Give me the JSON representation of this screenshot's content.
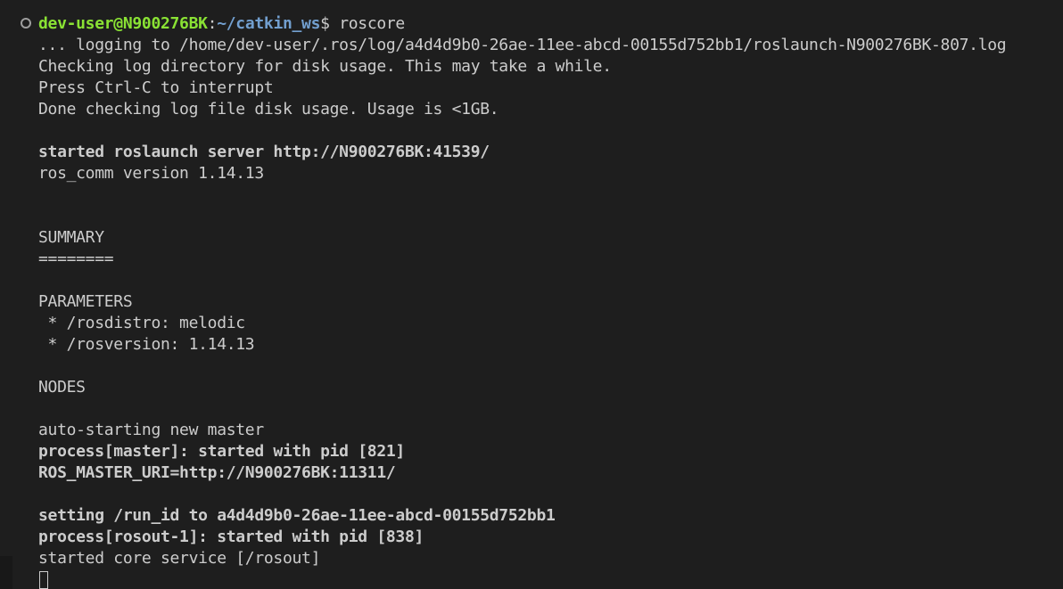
{
  "prompt": {
    "user_host": "dev-user@N900276BK",
    "separator": ":",
    "path": "~/catkin_ws",
    "symbol": "$ ",
    "command": "roscore"
  },
  "output": {
    "line_01": "... logging to /home/dev-user/.ros/log/a4d4d9b0-26ae-11ee-abcd-00155d752bb1/roslaunch-N900276BK-807.log",
    "line_02": "Checking log directory for disk usage. This may take a while.",
    "line_03": "Press Ctrl-C to interrupt",
    "line_04": "Done checking log file disk usage. Usage is <1GB.",
    "line_05": "started roslaunch server http://N900276BK:41539/",
    "line_06": "ros_comm version 1.14.13",
    "line_07": "SUMMARY",
    "line_08": "========",
    "line_09": "PARAMETERS",
    "line_10": " * /rosdistro: melodic",
    "line_11": " * /rosversion: 1.14.13",
    "line_12": "NODES",
    "line_13": "auto-starting new master",
    "line_14": "process[master]: started with pid [821]",
    "line_15": "ROS_MASTER_URI=http://N900276BK:11311/",
    "line_16": "setting /run_id to a4d4d9b0-26ae-11ee-abcd-00155d752bb1",
    "line_17": "process[rosout-1]: started with pid [838]",
    "line_18": "started core service [/rosout]"
  },
  "colors": {
    "background": "#1e1e1e",
    "foreground": "#cccccc",
    "user_host": "#8ae234",
    "path": "#729fcf"
  }
}
